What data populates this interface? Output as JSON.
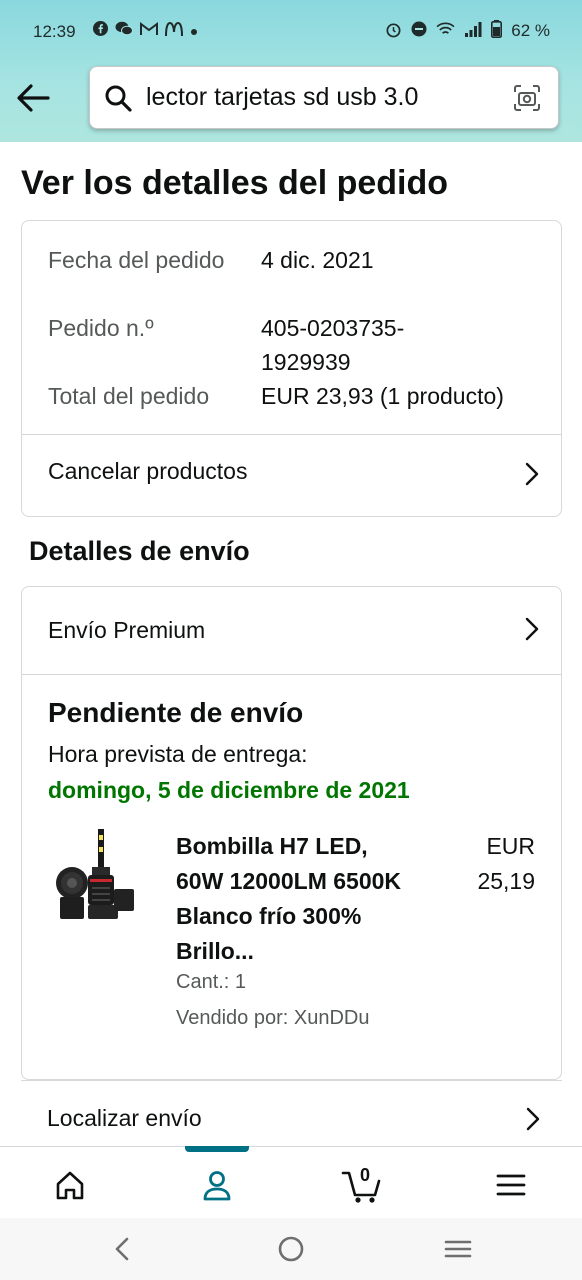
{
  "status_bar": {
    "time": "12:39",
    "battery": "62 %",
    "notification_icons": [
      "facebook-icon",
      "wechat-icon",
      "gmail-icon",
      "mcdonalds-icon",
      "dot-icon"
    ]
  },
  "search": {
    "query": "lector tarjetas sd usb 3.0"
  },
  "page": {
    "title": "Ver los detalles del pedido"
  },
  "order": {
    "date_label": "Fecha del pedido",
    "date_value": "4 dic. 2021",
    "number_label": "Pedido n.º",
    "number_value": "405-0203735-1929939",
    "total_label": "Total del pedido",
    "total_value": "EUR 23,93 (1 producto)",
    "cancel_label": "Cancelar productos"
  },
  "shipping": {
    "section_title": "Detalles de envío",
    "method": "Envío Premium",
    "status": "Pendiente de envío",
    "eta_label": "Hora prevista de entrega:",
    "eta_date": "domingo, 5 de diciembre de 2021",
    "track_label": "Localizar envío"
  },
  "product": {
    "name": "Bombilla H7 LED, 60W 12000LM 6500K Blanco frío 300% Brillo...",
    "price": "EUR 25,19",
    "qty": "Cant.: 1",
    "seller": "Vendido por: XunDDu"
  },
  "bottom_nav": {
    "items": [
      "home-icon",
      "account-icon",
      "cart-icon",
      "menu-icon"
    ],
    "cart_count": "0",
    "active_index": 1
  },
  "colors": {
    "accent_teal": "#007185",
    "green_date": "#007600",
    "header_gradient": "#8ad8de"
  }
}
